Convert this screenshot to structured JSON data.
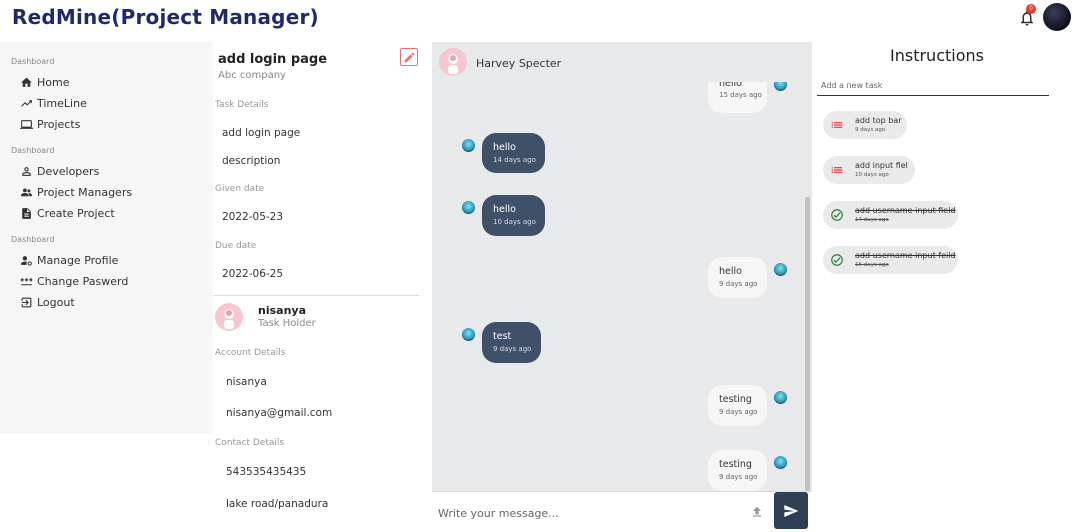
{
  "header": {
    "title": "RedMine(Project Manager)",
    "notification_count": "0"
  },
  "sidebar": {
    "sections": [
      {
        "label": "Dashboard",
        "items": [
          {
            "label": "Home",
            "icon": "home-icon"
          },
          {
            "label": "TimeLine",
            "icon": "trending-icon"
          },
          {
            "label": "Projects",
            "icon": "laptop-icon"
          }
        ]
      },
      {
        "label": "Dashboard",
        "items": [
          {
            "label": "Developers",
            "icon": "person-icon"
          },
          {
            "label": "Project Managers",
            "icon": "people-icon"
          },
          {
            "label": "Create Project",
            "icon": "document-icon"
          }
        ]
      },
      {
        "label": "Dashboard",
        "items": [
          {
            "label": "Manage Profile",
            "icon": "manage-account-icon"
          },
          {
            "label": "Change Paswerd",
            "icon": "password-icon"
          },
          {
            "label": "Logout",
            "icon": "logout-icon"
          }
        ]
      }
    ]
  },
  "task": {
    "title": "add login page",
    "company": "Abc company",
    "details_label": "Task Details",
    "name": "add login page",
    "description": "description",
    "given_date_label": "Given date",
    "given_date": "2022-05-23",
    "due_date_label": "Due date",
    "due_date": "2022-06-25"
  },
  "holder": {
    "name": "nisanya",
    "role": "Task Holder",
    "account_label": "Account Details",
    "username": "nisanya",
    "email": "nisanya@gmail.com",
    "contact_label": "Contact Details",
    "phone": "543535435435",
    "address": "lake road/panadura"
  },
  "chat": {
    "contact_name": "Harvey Specter",
    "messages": [
      {
        "text": "hello",
        "time": "15 days ago",
        "dir": "sent"
      },
      {
        "text": "hello",
        "time": "14 days ago",
        "dir": "recv"
      },
      {
        "text": "hello",
        "time": "10 days ago",
        "dir": "recv"
      },
      {
        "text": "hello",
        "time": "9 days ago",
        "dir": "sent"
      },
      {
        "text": "test",
        "time": "9 days ago",
        "dir": "recv"
      },
      {
        "text": "testing",
        "time": "9 days ago",
        "dir": "sent"
      },
      {
        "text": "testing",
        "time": "9 days ago",
        "dir": "sent"
      }
    ],
    "input_placeholder": "Write your message..."
  },
  "instructions": {
    "title": "Instructions",
    "input_placeholder": "Add a new task",
    "tasks": [
      {
        "name": "add top bar",
        "date": "9 days ago",
        "done": false
      },
      {
        "name": "add input fiel",
        "date": "10 days ago",
        "done": false
      },
      {
        "name": "add username input field",
        "date": "14 days ago",
        "done": true
      },
      {
        "name": "add username input feild",
        "date": "15 days ago",
        "done": true
      }
    ]
  },
  "colors": {
    "brand": "#1f2a6b",
    "received_bubble": "#3f5168",
    "sent_bubble": "#f6f6f7",
    "chat_bg": "#e8e9eb",
    "pending_icon": "#e53935",
    "done_icon": "#2e7d32"
  }
}
